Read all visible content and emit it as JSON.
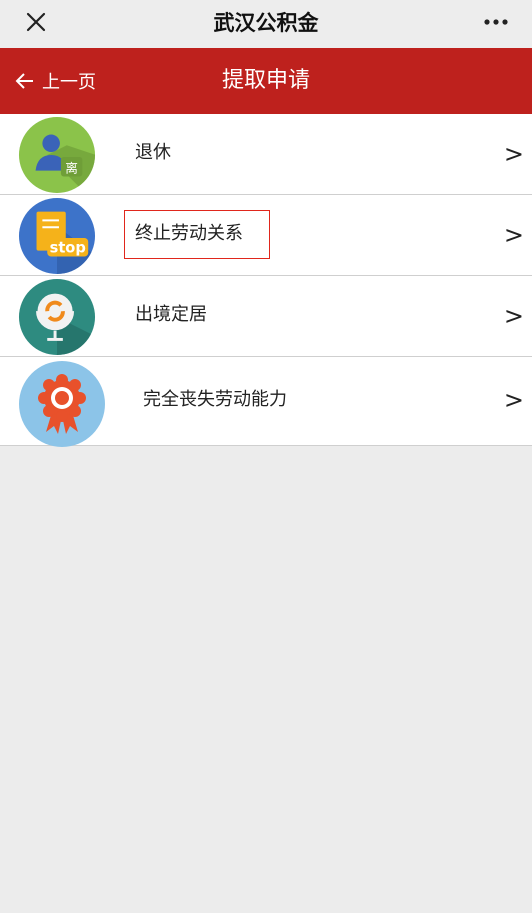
{
  "wechat_bar": {
    "title": "武汉公积金",
    "close_icon": "close-icon",
    "more_icon": "more-dots-icon"
  },
  "header": {
    "back_label": "上一页",
    "title": "提取申请",
    "background": "#be211d"
  },
  "list": {
    "items": [
      {
        "label": "退休",
        "icon": "retire-person-icon",
        "icon_badge": "离",
        "chevron": ">",
        "icon_color": "#8bc34a"
      },
      {
        "label": "终止劳动关系",
        "icon": "stop-document-icon",
        "icon_badge": "stop",
        "chevron": ">",
        "icon_color": "#3d73c9",
        "highlighted": true
      },
      {
        "label": "出境定居",
        "icon": "globe-icon",
        "chevron": ">",
        "icon_color": "#2e8b80"
      },
      {
        "label": "完全丧失劳动能力",
        "icon": "rosette-badge-icon",
        "chevron": ">",
        "icon_color": "#8cc4e8"
      }
    ]
  }
}
